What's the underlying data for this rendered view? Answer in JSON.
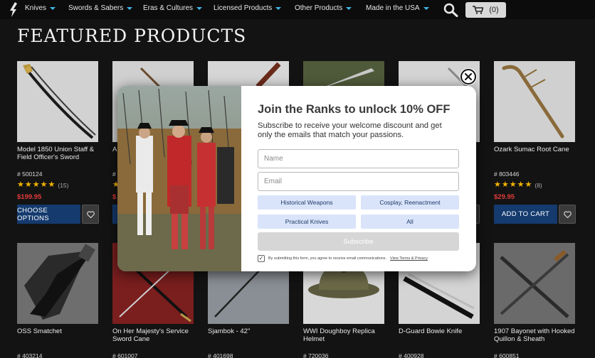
{
  "nav": {
    "items": [
      {
        "label": "Knives"
      },
      {
        "label": "Swords & Sabers"
      },
      {
        "label": "Eras & Cultures"
      },
      {
        "label": "Licensed Products"
      },
      {
        "label": "Other Products"
      },
      {
        "label": "Made in the USA"
      }
    ],
    "cart_count": "(0)",
    "caret_color": "#3fb6e6"
  },
  "page_title": "FEATURED PRODUCTS",
  "products_row1": [
    {
      "name": "Model 1850 Union Staff & Field Officer's Sword",
      "sku": "# 500124",
      "rating_count": "(15)",
      "price": "$199.95",
      "button": "CHOOSE OPTIONS"
    },
    {
      "name": "A",
      "sku": "#",
      "rating_count": "",
      "price": "$",
      "button": ""
    },
    {
      "name": "",
      "sku": "",
      "rating_count": "",
      "price": "",
      "button": ""
    },
    {
      "name": "",
      "sku": "",
      "rating_count": "",
      "price": "",
      "button": ""
    },
    {
      "name": "",
      "sku": "",
      "rating_count": "",
      "price": "",
      "button": ""
    },
    {
      "name": "Ozark Sumac Root Cane",
      "sku": "# 803446",
      "rating_count": "(8)",
      "price": "$29.95",
      "button": "ADD TO CART"
    }
  ],
  "products_row2": [
    {
      "name": "OSS Smatchet",
      "sku": "# 403214"
    },
    {
      "name": "On Her Majesty's Service Sword Cane",
      "sku": "# 601007"
    },
    {
      "name": "Sjambok - 42\"",
      "sku": "# 401698"
    },
    {
      "name": "WWI Doughboy Replica Helmet",
      "sku": "# 720036"
    },
    {
      "name": "D-Guard Bowie Knife",
      "sku": "# 400928"
    },
    {
      "name": "1907 Bayonet with Hooked Quillon & Sheath",
      "sku": "# 600851"
    }
  ],
  "modal": {
    "title": "Join the Ranks to unlock 10% OFF",
    "subtitle": "Subscribe to receive your welcome discount and get only the emails that match your passions.",
    "name_placeholder": "Name",
    "email_placeholder": "Email",
    "interests": [
      "Historical Weapons",
      "Cosplay, Reenactment",
      "Practical Knives",
      "All"
    ],
    "submit_label": "Subscribe",
    "consent_text": "By submitting this form, you agree to receive email communications.",
    "consent_link": "View Terms & Privacy",
    "check_mark": "✓"
  },
  "colors": {
    "price": "#e23a3a",
    "primary_button": "#143a6e",
    "chip": "#d9e4fb",
    "star": "#f4b400"
  }
}
